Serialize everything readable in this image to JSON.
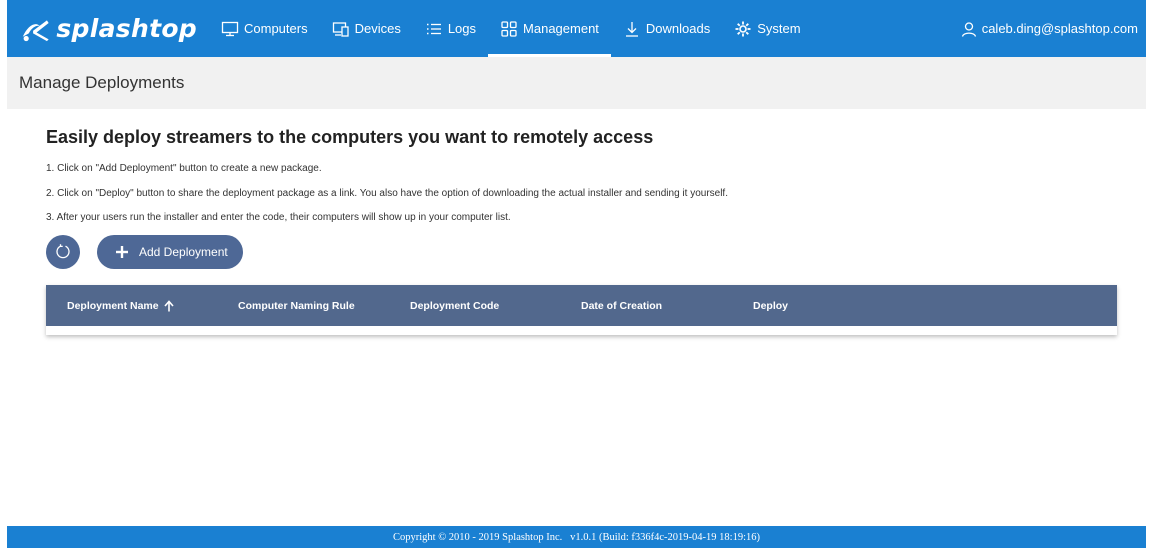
{
  "brand": {
    "name": "splashtop"
  },
  "nav": {
    "items": [
      {
        "label": "Computers",
        "icon": "monitor-icon"
      },
      {
        "label": "Devices",
        "icon": "devices-icon"
      },
      {
        "label": "Logs",
        "icon": "list-icon"
      },
      {
        "label": "Management",
        "icon": "grid-icon",
        "active": true
      },
      {
        "label": "Downloads",
        "icon": "download-icon"
      },
      {
        "label": "System",
        "icon": "gear-icon"
      }
    ],
    "user": "caleb.ding@splashtop.com"
  },
  "page": {
    "title": "Manage Deployments"
  },
  "main": {
    "heading": "Easily deploy streamers to the computers you want to remotely access",
    "steps": [
      "1. Click on \"Add Deployment\" button to create a new package.",
      "2. Click on \"Deploy\" button to share the deployment package as a link. You also have the option of downloading the actual installer and sending it yourself.",
      "3. After your users run the installer and enter the code, their computers will show up in your computer list."
    ],
    "add_button": "Add Deployment"
  },
  "table": {
    "columns": [
      "Deployment Name",
      "Computer Naming Rule",
      "Deployment Code",
      "Date of Creation",
      "Deploy"
    ],
    "sorted_column": "Deployment Name",
    "sort_direction": "ascending",
    "rows": []
  },
  "footer": {
    "text": "Copyright © 2010 - 2019 Splashtop Inc.   v1.0.1 (Build: f336f4c-2019-04-19 18:19:16)"
  },
  "colors": {
    "primary": "#1a80d2",
    "table_header": "#52688d",
    "button": "#4e6896",
    "page_header_bg": "#f1f1f1"
  }
}
